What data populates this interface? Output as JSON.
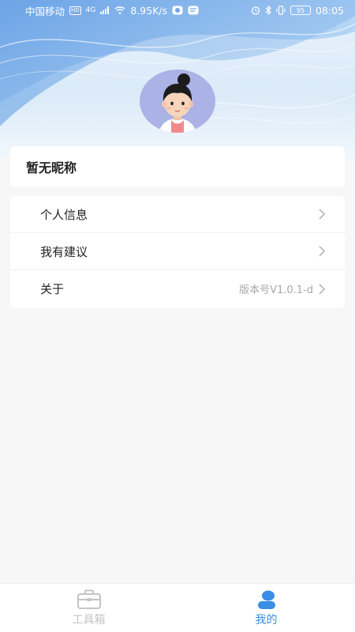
{
  "status_bar": {
    "carrier": "中国移动",
    "hd_badge": "HD",
    "signal": "4G",
    "speed": "8.95K/s",
    "battery": "95",
    "time": "08:05"
  },
  "profile": {
    "nickname": "暂无昵称"
  },
  "menu": {
    "items": [
      {
        "label": "个人信息",
        "value": ""
      },
      {
        "label": "我有建议",
        "value": ""
      },
      {
        "label": "关于",
        "value": "版本号V1.0.1-d"
      }
    ]
  },
  "tabbar": {
    "tabs": [
      {
        "label": "工具箱",
        "active": false,
        "icon": "toolbox-icon"
      },
      {
        "label": "我的",
        "active": true,
        "icon": "user-icon"
      }
    ]
  },
  "colors": {
    "accent": "#3a8ee6",
    "background": "#f7f7f7",
    "avatar_bg": "#aab2e6",
    "inactive_tab": "#c4c4c4"
  }
}
